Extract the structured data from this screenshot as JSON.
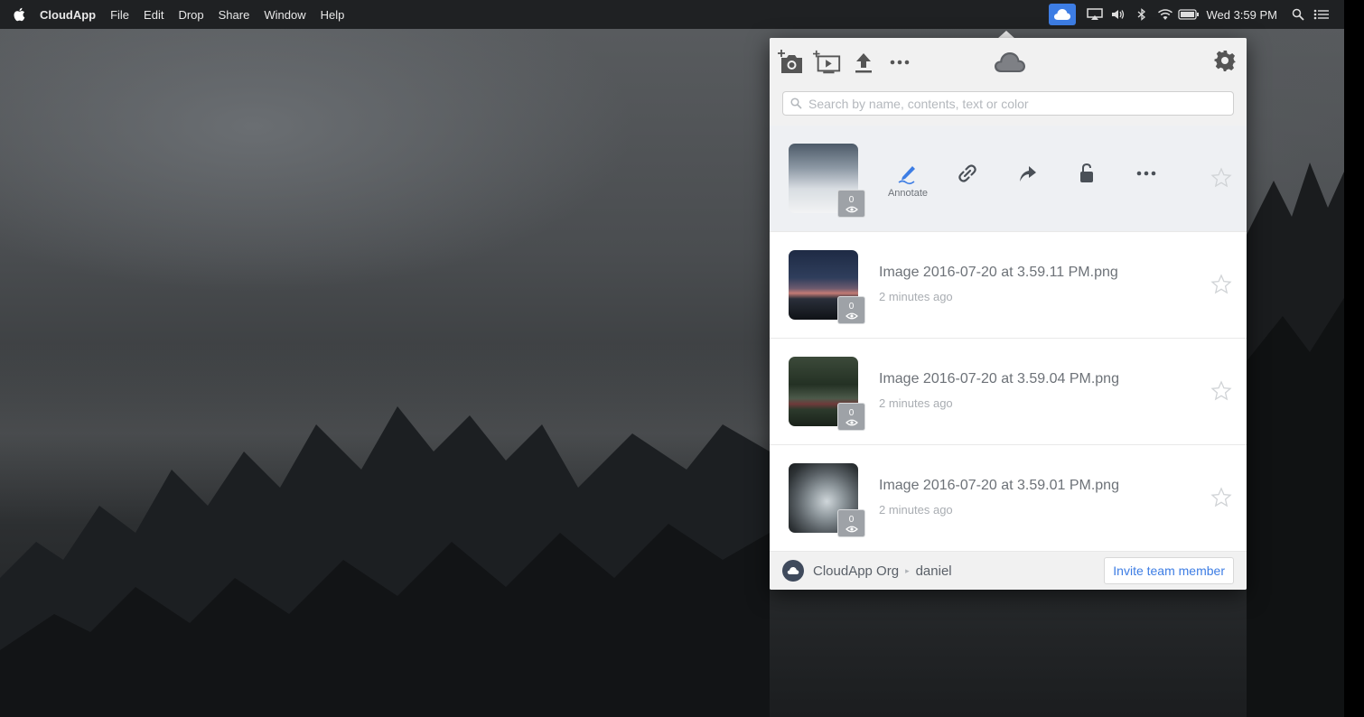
{
  "menubar": {
    "apple_icon": "apple-icon",
    "items": [
      "CloudApp",
      "File",
      "Edit",
      "Drop",
      "Share",
      "Window",
      "Help"
    ],
    "clock": "Wed 3:59 PM"
  },
  "toolbar": {
    "icons": [
      "screenshot-icon",
      "record-video-icon",
      "upload-icon",
      "more-icon",
      "cloud-icon",
      "gear-icon"
    ]
  },
  "search": {
    "placeholder": "Search by name, contents, text or color",
    "value": ""
  },
  "selected_item": {
    "views": "0",
    "actions": [
      {
        "icon": "annotate-icon",
        "label": "Annotate"
      },
      {
        "icon": "link-icon",
        "label": ""
      },
      {
        "icon": "share-icon",
        "label": ""
      },
      {
        "icon": "lock-icon",
        "label": ""
      },
      {
        "icon": "more-icon",
        "label": ""
      }
    ]
  },
  "items": [
    {
      "name": "Image 2016-07-20 at 3.59.11 PM.png",
      "time": "2 minutes ago",
      "views": "0"
    },
    {
      "name": "Image 2016-07-20 at 3.59.04 PM.png",
      "time": "2 minutes ago",
      "views": "0"
    },
    {
      "name": "Image 2016-07-20 at 3.59.01 PM.png",
      "time": "2 minutes ago",
      "views": "0"
    }
  ],
  "footer": {
    "org": "CloudApp Org",
    "user": "daniel",
    "invite_label": "Invite team member"
  },
  "colors": {
    "accent": "#3d7de4",
    "popover_bg": "#ffffff",
    "toolbar_bg": "#f1f1f1",
    "selected_row_bg": "#eef0f3"
  }
}
